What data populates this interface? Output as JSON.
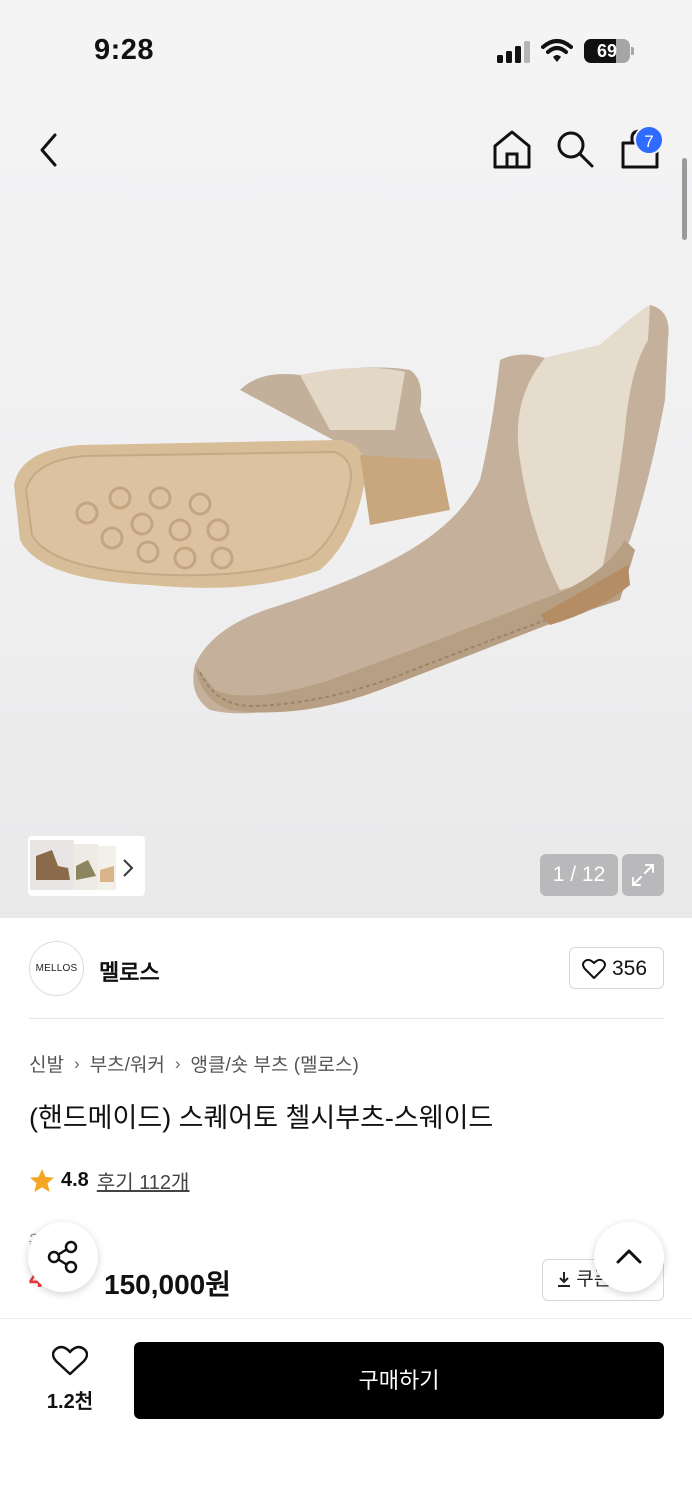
{
  "status_bar": {
    "time": "9:28",
    "battery": "69",
    "battery_level": 0.69
  },
  "nav": {
    "cart_count": "7"
  },
  "gallery": {
    "counter": "1 / 12"
  },
  "brand": {
    "logo_text": "MELLOS",
    "name": "멜로스",
    "like_count": "356"
  },
  "breadcrumb": [
    "신발",
    "부츠/워커",
    "앵클/숏 부츠 (멜로스)"
  ],
  "product": {
    "title": "(핸드메이드) 스퀘어토 첼시부츠-스웨이드",
    "rating": "4.8",
    "review_link": "후기 112개",
    "original_price": "3 90원",
    "discount": "4 %",
    "price": "150,000원",
    "coupon_label": "쿠폰"
  },
  "bottom": {
    "wish_count": "1.2천",
    "buy_label": "구매하기"
  },
  "colors": {
    "accent_badge": "#2f6bff",
    "discount": "#f03a3a",
    "star": "#f5a623",
    "buy_button": "#000000"
  },
  "icons": [
    "back-icon",
    "home-icon",
    "search-icon",
    "shopping-bag-icon",
    "expand-icon",
    "heart-icon",
    "star-icon",
    "share-icon",
    "chevron-up-icon",
    "download-icon"
  ]
}
